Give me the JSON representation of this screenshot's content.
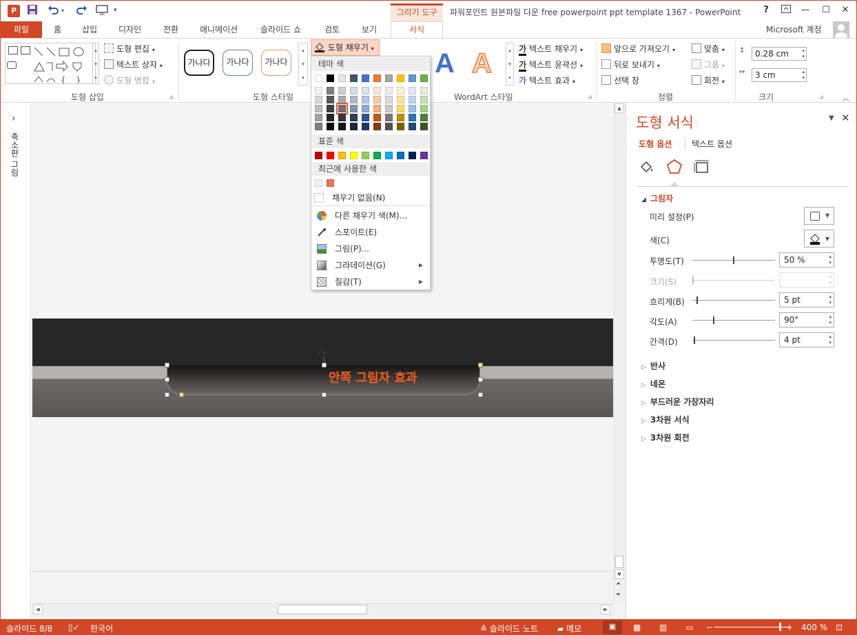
{
  "title_bar": {
    "context_tab": "그리기 도구",
    "title": "파워포인트 원본파일 다운 free powerpoint ppt template 1367 - PowerPoint",
    "help": "?",
    "minimize": "—",
    "maximize": "☐",
    "close": "✕"
  },
  "tabs": [
    "파일",
    "홈",
    "삽입",
    "디자인",
    "전환",
    "애니메이션",
    "슬라이드 쇼",
    "검토",
    "보기",
    "서식"
  ],
  "account": "Microsoft 계정",
  "ribbon": {
    "shape_insert": {
      "edit_shape": "도형 편집",
      "text_box": "텍스트 상자",
      "merge_shapes": "도형 병합",
      "label": "도형 삽입"
    },
    "shape_styles": {
      "samples": [
        "가나다",
        "가나다",
        "가나다"
      ],
      "fill": "도형 채우기",
      "label": "도형 스타일"
    },
    "wordart": {
      "letters": [
        "A",
        "A"
      ],
      "text_fill": "텍스트 채우기",
      "text_outline": "텍스트 윤곽선",
      "text_effects": "텍스트 효과",
      "label": "WordArt 스타일"
    },
    "arrange": {
      "bring_forward": "앞으로 가져오기",
      "send_backward": "뒤로 보내기",
      "selection_pane": "선택 창",
      "align": "맞춤",
      "group": "그룹",
      "rotate": "회전",
      "label": "정렬"
    },
    "size": {
      "height": "0.28 cm",
      "width": "3 cm",
      "label": "크기"
    }
  },
  "fill_menu": {
    "theme_colors_label": "테마 색",
    "theme_top": [
      "#ffffff",
      "#000000",
      "#e7e6e6",
      "#44546a",
      "#4472c4",
      "#ed7d31",
      "#a5a5a5",
      "#ffc000",
      "#5b9bd5",
      "#70ad47"
    ],
    "theme_shades": [
      [
        "#f2f2f2",
        "#7f7f7f",
        "#d0cece",
        "#d6dce4",
        "#d9e2f3",
        "#fbe5d5",
        "#ededed",
        "#fff2cc",
        "#deebf6",
        "#e2efd9"
      ],
      [
        "#d8d8d8",
        "#595959",
        "#aeaaaa",
        "#adb9ca",
        "#b4c6e7",
        "#f7cbac",
        "#dbdbdb",
        "#fee599",
        "#bdd7ee",
        "#c5e0b3"
      ],
      [
        "#bfbfbf",
        "#3f3f3f",
        "#757070",
        "#8496b0",
        "#8eaadb",
        "#f4b183",
        "#c9c9c9",
        "#ffd965",
        "#9cc3e5",
        "#a8d08d"
      ],
      [
        "#a5a5a5",
        "#262626",
        "#3a3838",
        "#323f4f",
        "#2f5496",
        "#c55a11",
        "#7b7b7b",
        "#bf9000",
        "#2e75b5",
        "#538135"
      ],
      [
        "#7f7f7f",
        "#0c0c0c",
        "#171616",
        "#222a35",
        "#1f3864",
        "#833c0b",
        "#525252",
        "#7f6000",
        "#1e4e79",
        "#375623"
      ]
    ],
    "standard_label": "표준 색",
    "standard_colors": [
      "#c00000",
      "#ff0000",
      "#ffc000",
      "#ffff00",
      "#92d050",
      "#00b050",
      "#00b0f0",
      "#0070c0",
      "#002060",
      "#7030a0"
    ],
    "recent_label": "최근에 사용한 색",
    "recent_colors": [
      "#f2f2f2",
      "#e8735a"
    ],
    "no_fill": "채우기 없음(N)",
    "more_colors": "다른 채우기 색(M)...",
    "eyedropper": "스포이트(E)",
    "picture": "그림(P)...",
    "gradient": "그라데이션(G)",
    "texture": "질감(T)"
  },
  "left_pane": {
    "label": "축소판 그림",
    "expand": "›"
  },
  "slide": {
    "shape_text": "안쪽 그림자 효과",
    "rotate_handle": "⟳"
  },
  "format_pane": {
    "title": "도형 서식",
    "tab_shape": "도형 옵션",
    "tab_text": "텍스트 옵션",
    "shadow_section": "그림자",
    "rows": [
      {
        "label": "미리 설정(P)"
      },
      {
        "label": "색(C)"
      },
      {
        "label": "투명도(T)",
        "value": "50 %",
        "level": 0.5
      },
      {
        "label": "크기(S)",
        "value": "",
        "level": 0
      },
      {
        "label": "흐리게(B)",
        "value": "5 pt",
        "level": 0.05
      },
      {
        "label": "각도(A)",
        "value": "90°",
        "level": 0.25
      },
      {
        "label": "간격(D)",
        "value": "4 pt",
        "level": 0.02
      }
    ],
    "sections": [
      "반사",
      "네온",
      "부드러운 가장자리",
      "3차원 서식",
      "3차원 회전"
    ]
  },
  "status_bar": {
    "slide": "슬라이드 8/8",
    "language": "한국어",
    "notes": "슬라이드 노트",
    "comments": "메모",
    "zoom_minus": "−",
    "zoom_plus": "+",
    "zoom": "400 %"
  },
  "colors": {
    "accent": "#d24726",
    "shape_text": "#ff5a1f"
  }
}
